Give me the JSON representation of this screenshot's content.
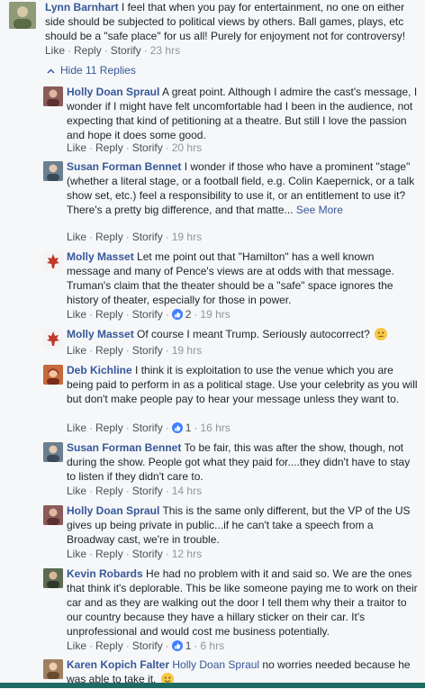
{
  "actions_labels": {
    "like": "Like",
    "reply": "Reply",
    "storify": "Storify"
  },
  "top_comment": {
    "author": "Lynn Barnhart",
    "text": " I feel that when you pay for entertainment, no one on either side should be subjected to political views by others. Ball games, plays, etc should be a \"safe place\" for us all! Purely for enjoyment not for controversy!",
    "time": "23 hrs",
    "avatar_icon": "profile-photo",
    "avatar_color": "#7d8a6b"
  },
  "hide_replies_label": "Hide 11 Replies",
  "replies": [
    {
      "author": "Holly Doan Spraul",
      "text": " A great point. Although I admire the cast's message, I wonder if I might have felt uncomfortable had I been in the audience, not expecting that kind of petitioning at a theatre. But still I love the passion and hope it does some good.",
      "time": "20 hrs",
      "avatar_color": "#8b5a5a"
    },
    {
      "author": "Susan Forman Bennet",
      "text": " I wonder if those who have a prominent \"stage\" (whether a literal stage, or a football field, e.g. Colin Kaepernick, or a talk show set, etc.) feel a responsibility to use it, or an entitlement to use it? There's a pretty big difference, and that matte...",
      "see_more": "See More",
      "time": "19 hrs",
      "avatar_color": "#6a7f8f"
    },
    {
      "author": "Molly Masset",
      "text": " Let me point out that \"Hamilton\" has a well known message and many of Pence's views are at odds with that message. Truman's claim that the theater should be a \"safe\" space ignores the history of theater, especially for those in power.",
      "likes": "2",
      "time": "19 hrs",
      "avatar_color": "#c0392b"
    },
    {
      "author": "Molly Masset",
      "text": " Of course I meant Trump. Seriously autocorrect?",
      "emoji": "confused-emoji",
      "time": "19 hrs",
      "avatar_color": "#c0392b"
    },
    {
      "author": "Deb Kichline",
      "text": " I think it is exploitation to use the venue which you are being paid to perform in as a political stage. Use your celebrity as you will but don't make people pay to hear your message unless they want to.",
      "likes": "1",
      "time": "16 hrs",
      "avatar_color": "#b5523b"
    },
    {
      "author": "Susan Forman Bennet",
      "text": " To be fair, this was after the show, though, not during the show. People got what they paid for....they didn't have to stay to listen if they didn't care to.",
      "time": "14 hrs",
      "avatar_color": "#6a7f8f"
    },
    {
      "author": "Holly Doan Spraul",
      "text": " This is the same only different, but the VP of the US gives up being private in public...if he can't take a speech from a Broadway cast, we're in trouble.",
      "time": "12 hrs",
      "avatar_color": "#8b5a5a"
    },
    {
      "author": "Kevin Robards",
      "text": " He had no problem with it and said so. We are the ones that think it's deplorable. This be like someone paying me to work on their car and as they are walking out the door I tell them why their a traitor to our country because they have a hillary sticker on their car. It's unprofessional and would cost me business potentially.",
      "likes": "1",
      "time": "6 hrs",
      "avatar_color": "#5d6b52"
    },
    {
      "author": "Karen Kopich Falter",
      "mention": "Holly Doan Spraul",
      "text": " no worries needed because he was able to take it.",
      "emoji": "smile-emoji",
      "avatar_color": "#a08060"
    }
  ]
}
